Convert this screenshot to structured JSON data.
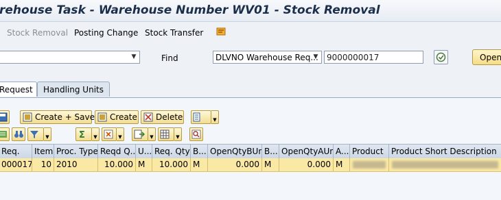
{
  "title": "rehouse Task - Warehouse Number WV01 - Stock Removal",
  "menu": {
    "stock_removal": "Stock Removal",
    "posting_change": "Posting Change",
    "stock_transfer": "Stock Transfer"
  },
  "find": {
    "label": "Find",
    "type_value": "DLVNO Warehouse Req...",
    "value": "9000000017",
    "open_label": "Open"
  },
  "tabs": [
    {
      "label": "Request"
    },
    {
      "label": "Handling Units"
    }
  ],
  "toolbar": {
    "create_save": "Create + Save",
    "create": "Create",
    "delete": "Delete"
  },
  "grid": {
    "columns": [
      "Req.",
      "Item",
      "Proc. Type",
      "Reqd Q...",
      "U...",
      "Req. Qty",
      "B...",
      "OpenQtyBUn",
      "B...",
      "OpenQtyAUn",
      "A...",
      "Product",
      "Product Short Description"
    ],
    "row": [
      "000017",
      "10",
      "2010",
      "10.000",
      "M",
      "10.000",
      "M",
      "0.000",
      "M",
      "0.000",
      "M",
      "",
      ""
    ]
  },
  "colors": {
    "accent_yellow": "#f3dd92",
    "selected_row": "#fae8a5",
    "title_color": "#1c2f4a"
  }
}
